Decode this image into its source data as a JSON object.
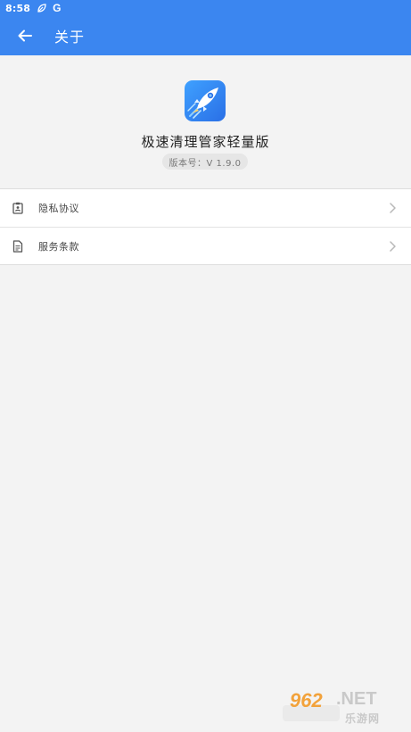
{
  "status_bar": {
    "time": "8:58",
    "icons": [
      "leaf-icon",
      "google-icon"
    ],
    "google_glyph": "G"
  },
  "app_bar": {
    "title": "关于",
    "back_icon": "arrow-left-icon",
    "color": "#3b86f0"
  },
  "about": {
    "app_name": "极速清理管家轻量版",
    "version": "版本号：V 1.9.0",
    "icon": "rocket-icon"
  },
  "menu": {
    "items": [
      {
        "label": "隐私协议",
        "icon": "clipboard-person-icon",
        "trailing_icon": "chevron-right-icon"
      },
      {
        "label": "服务条款",
        "icon": "document-icon",
        "trailing_icon": "chevron-right-icon"
      }
    ]
  },
  "watermark": {
    "number": "962",
    "suffix": ".NET",
    "site": "乐游网"
  }
}
